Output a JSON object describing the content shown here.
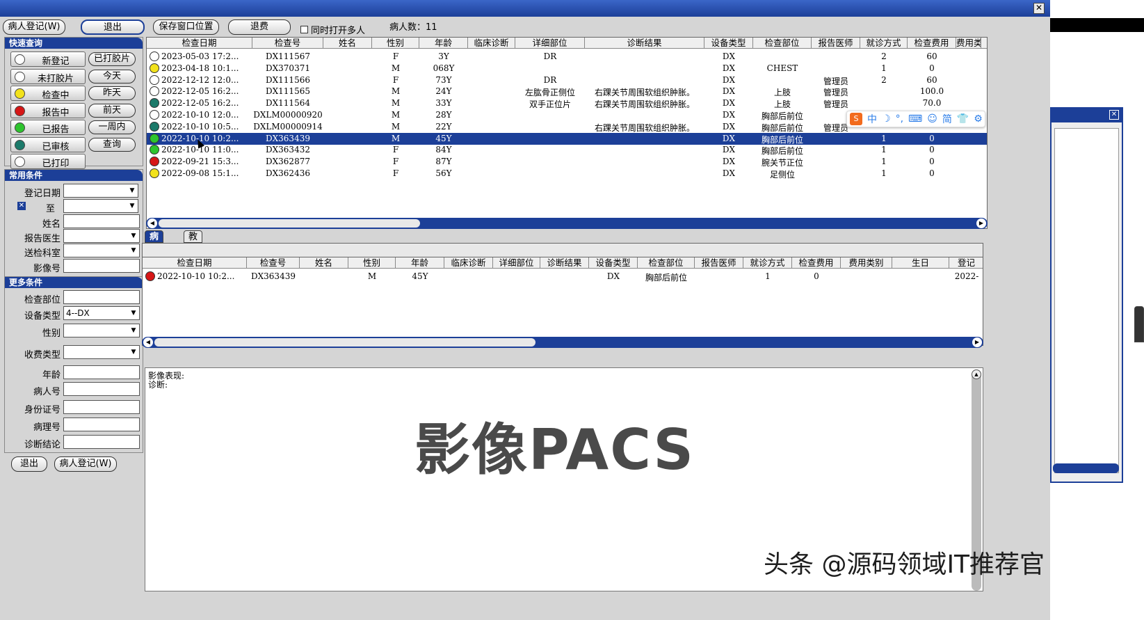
{
  "window": {
    "close_glyph": "✕"
  },
  "toolbar": {
    "register_label": "病人登记(W)",
    "exit_label": "退出",
    "save_position_label": "保存窗口位置",
    "refund_label": "退费",
    "multi_open_label": "同时打开多人",
    "patient_count_label": "病人数：11"
  },
  "quick": {
    "title": "快速查询",
    "items": [
      {
        "label": "新登记",
        "color": "#ffffff",
        "side": "已打胶片"
      },
      {
        "label": "未打胶片",
        "color": "#ffffff",
        "side": "今天"
      },
      {
        "label": "检查中",
        "color": "#f2e21c",
        "side": "昨天"
      },
      {
        "label": "报告中",
        "color": "#d61616",
        "side": "前天"
      },
      {
        "label": "已报告",
        "color": "#2ec42e",
        "side": "一周内"
      },
      {
        "label": "已审核",
        "color": "#1b7a6a",
        "side": "查询"
      },
      {
        "label": "已打印",
        "color": "#ffffff",
        "side": ""
      }
    ]
  },
  "common": {
    "title": "常用条件",
    "date_label": "登记日期",
    "to_label": "至",
    "name_label": "姓名",
    "doctor_label": "报告医生",
    "dept_label": "送检科室",
    "image_no_label": "影像号"
  },
  "more": {
    "title": "更多条件",
    "part_label": "检查部位",
    "device_label": "设备类型",
    "device_value": "4--DX",
    "sex_label": "性别",
    "fee_type_label": "收费类型",
    "age_label": "年龄",
    "patient_no_label": "病人号",
    "id_label": "身份证号",
    "pathology_label": "病理号",
    "diagnosis_label": "诊断结论"
  },
  "bottom": {
    "exit_label": "退出",
    "register_label": "病人登记(W)"
  },
  "main_table": {
    "columns": [
      "检查日期",
      "检查号",
      "姓名",
      "性别",
      "年龄",
      "临床诊断",
      "详细部位",
      "诊断结果",
      "设备类型",
      "检查部位",
      "报告医师",
      "就诊方式",
      "检查费用",
      "费用类"
    ],
    "rows": [
      {
        "status": "#ffffff",
        "date": "2023-05-03 17:2...",
        "no": "DX111567",
        "name": "",
        "sex": "F",
        "age": "3Y",
        "clinic": "",
        "detail": "DR",
        "result": "",
        "device": "DX",
        "part": "",
        "doctor": "",
        "visit": "2",
        "fee": "60"
      },
      {
        "status": "#f2e21c",
        "date": "2023-04-18 10:1...",
        "no": "DX370371",
        "name": "",
        "sex": "M",
        "age": "068Y",
        "clinic": "",
        "detail": "",
        "result": "",
        "device": "DX",
        "part": "CHEST",
        "doctor": "",
        "visit": "1",
        "fee": "0"
      },
      {
        "status": "#ffffff",
        "date": "2022-12-12 12:0...",
        "no": "DX111566",
        "name": "",
        "sex": "F",
        "age": "73Y",
        "clinic": "",
        "detail": "DR",
        "result": "",
        "device": "DX",
        "part": "",
        "doctor": "管理员",
        "visit": "2",
        "fee": "60"
      },
      {
        "status": "#ffffff",
        "date": "2022-12-05 16:2...",
        "no": "DX111565",
        "name": "",
        "sex": "M",
        "age": "24Y",
        "clinic": "",
        "detail": "左肱骨正侧位",
        "result": "右踝关节周围软组织肿胀。",
        "device": "DX",
        "part": "上肢",
        "doctor": "管理员",
        "visit": "",
        "fee": "100.0"
      },
      {
        "status": "#1b7a6a",
        "date": "2022-12-05 16:2...",
        "no": "DX111564",
        "name": "",
        "sex": "M",
        "age": "33Y",
        "clinic": "",
        "detail": "双手正位片",
        "result": "右踝关节周围软组织肿胀。",
        "device": "DX",
        "part": "上肢",
        "doctor": "管理员",
        "visit": "",
        "fee": "70.0"
      },
      {
        "status": "#ffffff",
        "date": "2022-10-10 12:0...",
        "no": "DXLM00000920",
        "name": "",
        "sex": "M",
        "age": "28Y",
        "clinic": "",
        "detail": "",
        "result": "",
        "device": "DX",
        "part": "胸部后前位",
        "doctor": "",
        "visit": "",
        "fee": ""
      },
      {
        "status": "#1b7a6a",
        "date": "2022-10-10 10:5...",
        "no": "DXLM00000914",
        "name": "",
        "sex": "M",
        "age": "22Y",
        "clinic": "",
        "detail": "",
        "result": "右踝关节周围软组织肿胀。",
        "device": "DX",
        "part": "胸部后前位",
        "doctor": "管理员",
        "visit": "",
        "fee": ""
      },
      {
        "status": "#2ec42e",
        "date": "2022-10-10 10:2...",
        "no": "DX363439",
        "name": "",
        "sex": "M",
        "age": "45Y",
        "clinic": "",
        "detail": "",
        "result": "",
        "device": "DX",
        "part": "胸部后前位",
        "doctor": "",
        "visit": "1",
        "fee": "0"
      },
      {
        "status": "#2ec42e",
        "date": "2022-10-10 11:0...",
        "no": "DX363432",
        "name": "",
        "sex": "F",
        "age": "84Y",
        "clinic": "",
        "detail": "",
        "result": "",
        "device": "DX",
        "part": "胸部后前位",
        "doctor": "",
        "visit": "1",
        "fee": "0"
      },
      {
        "status": "#d61616",
        "date": "2022-09-21 15:3...",
        "no": "DX362877",
        "name": "",
        "sex": "F",
        "age": "87Y",
        "clinic": "",
        "detail": "",
        "result": "",
        "device": "DX",
        "part": "腕关节正位",
        "doctor": "",
        "visit": "1",
        "fee": "0"
      },
      {
        "status": "#f2e21c",
        "date": "2022-09-08 15:1...",
        "no": "DX362436",
        "name": "",
        "sex": "F",
        "age": "56Y",
        "clinic": "",
        "detail": "",
        "result": "",
        "device": "DX",
        "part": "足侧位",
        "doctor": "",
        "visit": "1",
        "fee": "0"
      }
    ],
    "selected_row": 7
  },
  "tabs": {
    "patient_lib": "病人库",
    "teaching_lib": "教学库"
  },
  "sub_table": {
    "columns": [
      "检查日期",
      "检查号",
      "姓名",
      "性别",
      "年龄",
      "临床诊断",
      "详细部位",
      "诊断结果",
      "设备类型",
      "检查部位",
      "报告医师",
      "就诊方式",
      "检查费用",
      "费用类别",
      "生日",
      "登记"
    ],
    "rows": [
      {
        "status": "#d61616",
        "date": "2022-10-10 10:2...",
        "no": "DX363439",
        "sex": "M",
        "age": "45Y",
        "device": "DX",
        "part": "胸部后前位",
        "visit": "1",
        "fee": "0",
        "reg": "2022-"
      }
    ]
  },
  "report": {
    "findings_label": "影像表现:",
    "diagnosis_label": "诊断:"
  },
  "overlay": {
    "title": "影像PACS",
    "credit": "头条 @源码领域IT推荐官"
  },
  "ime": {
    "items": [
      "中",
      "☽",
      "°,",
      "⌨",
      "☺",
      "简",
      "👕",
      "⚙"
    ]
  }
}
